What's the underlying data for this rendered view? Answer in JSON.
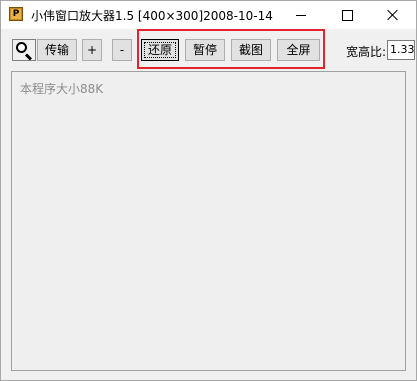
{
  "window": {
    "title": "小伟窗口放大器1.5 [400×300]2008-10-14",
    "app_icon_letter": "P"
  },
  "toolbar": {
    "transfer_label": "传输",
    "plus_label": "+",
    "minus_label": "-",
    "restore_label": "还原",
    "pause_label": "暂停",
    "capture_label": "截图",
    "fullscreen_label": "全屏",
    "ratio_label": "宽高比:",
    "ratio_value": "1.33"
  },
  "display": {
    "size_note": "本程序大小88K"
  },
  "colors": {
    "highlight_border": "#e5232a",
    "window_bg": "#f0f0f0",
    "button_bg": "#e1e1e1",
    "note_text": "#8c8c8c"
  },
  "icons": {
    "magnifier": "magnifier-icon",
    "minimize": "minimize-icon",
    "maximize": "maximize-icon",
    "close": "close-icon"
  }
}
